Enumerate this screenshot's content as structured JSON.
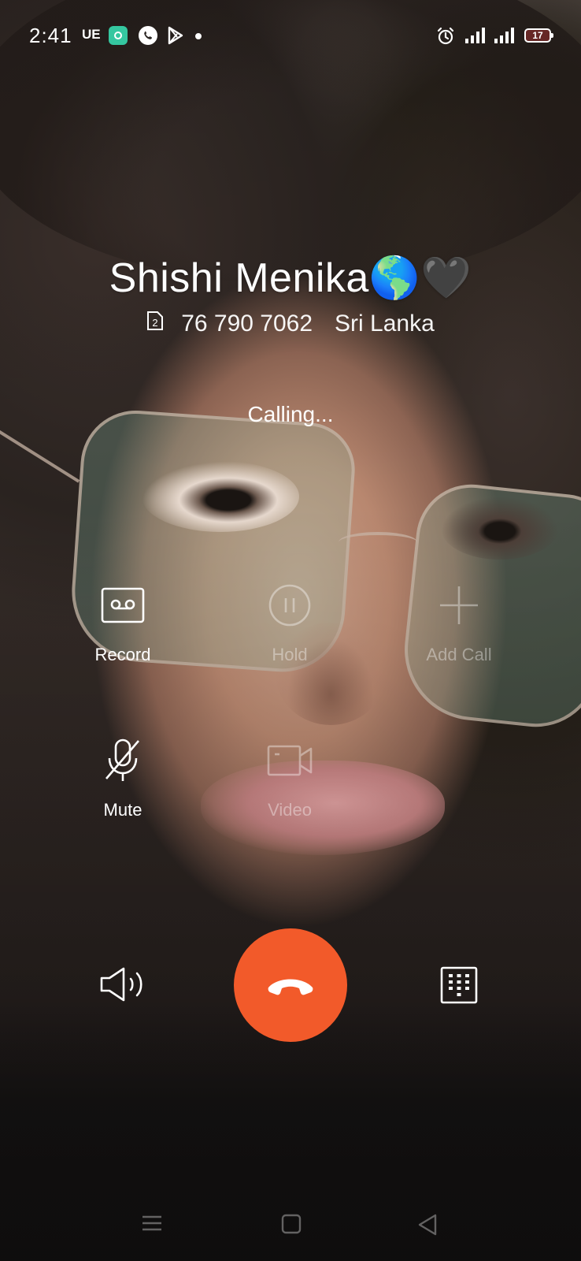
{
  "status_bar": {
    "time": "2:41",
    "network_badge": "UE",
    "battery_level": "17"
  },
  "caller": {
    "name": "Shishi Menika🌎🖤",
    "sim_slot": "2",
    "number": "76 790 7062",
    "location": "Sri Lanka",
    "status": "Calling..."
  },
  "actions": {
    "record": "Record",
    "hold": "Hold",
    "add_call": "Add Call",
    "mute": "Mute",
    "video": "Video"
  },
  "icons": {
    "record": "cassette-icon",
    "hold": "pause-circle-icon",
    "add_call": "plus-icon",
    "mute": "mic-off-icon",
    "video": "video-camera-icon",
    "speaker": "speaker-icon",
    "end_call": "hang-up-icon",
    "dialpad": "dialpad-icon"
  },
  "colors": {
    "end_call": "#f25a2a",
    "battery_low": "#e63c3c",
    "app_badge": "#35c7a0"
  }
}
